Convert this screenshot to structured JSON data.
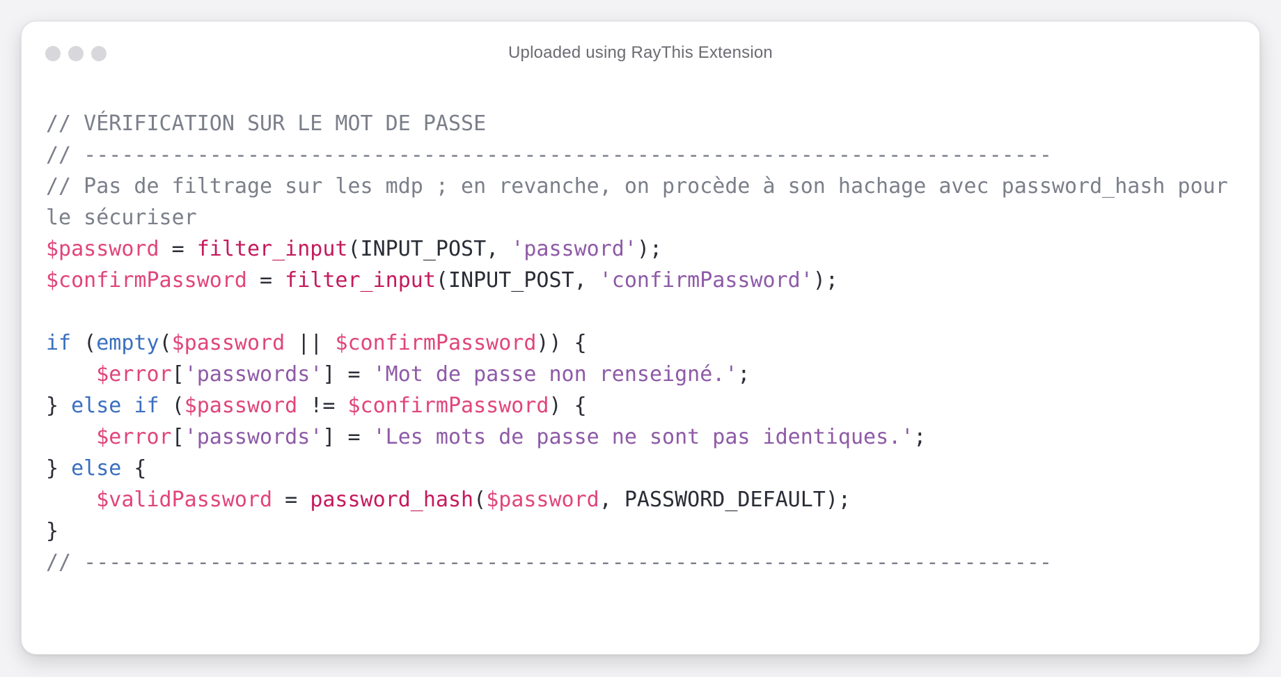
{
  "window": {
    "title": "Uploaded using RayThis Extension"
  },
  "colors": {
    "comment": "#7b7f8a",
    "variable": "#e0457b",
    "function": "#c41a5c",
    "string": "#8e5aa7",
    "keyword": "#3a6fbf",
    "plain": "#2a2c36"
  },
  "code": {
    "lines": [
      [
        {
          "t": "comment",
          "v": "// VÉRIFICATION SUR LE MOT DE PASSE"
        }
      ],
      [
        {
          "t": "comment",
          "v": "// -----------------------------------------------------------------------------"
        }
      ],
      [
        {
          "t": "comment",
          "v": "// Pas de filtrage sur les mdp ; en revanche, on procède à son hachage avec password_hash pour"
        }
      ],
      [
        {
          "t": "comment",
          "v": "le sécuriser"
        }
      ],
      [
        {
          "t": "var",
          "v": "$password"
        },
        {
          "t": "plain",
          "v": " = "
        },
        {
          "t": "func",
          "v": "filter_input"
        },
        {
          "t": "plain",
          "v": "(INPUT_POST, "
        },
        {
          "t": "str",
          "v": "'password'"
        },
        {
          "t": "plain",
          "v": ");"
        }
      ],
      [
        {
          "t": "var",
          "v": "$confirmPassword"
        },
        {
          "t": "plain",
          "v": " = "
        },
        {
          "t": "func",
          "v": "filter_input"
        },
        {
          "t": "plain",
          "v": "(INPUT_POST, "
        },
        {
          "t": "str",
          "v": "'confirmPassword'"
        },
        {
          "t": "plain",
          "v": ");"
        }
      ],
      [],
      [
        {
          "t": "kw",
          "v": "if"
        },
        {
          "t": "plain",
          "v": " ("
        },
        {
          "t": "kw",
          "v": "empty"
        },
        {
          "t": "plain",
          "v": "("
        },
        {
          "t": "var",
          "v": "$password"
        },
        {
          "t": "plain",
          "v": " || "
        },
        {
          "t": "var",
          "v": "$confirmPassword"
        },
        {
          "t": "plain",
          "v": ")) {"
        }
      ],
      [
        {
          "t": "plain",
          "v": "    "
        },
        {
          "t": "var",
          "v": "$error"
        },
        {
          "t": "plain",
          "v": "["
        },
        {
          "t": "str",
          "v": "'passwords'"
        },
        {
          "t": "plain",
          "v": "] = "
        },
        {
          "t": "str",
          "v": "'Mot de passe non renseigné.'"
        },
        {
          "t": "plain",
          "v": ";"
        }
      ],
      [
        {
          "t": "plain",
          "v": "} "
        },
        {
          "t": "kw",
          "v": "else"
        },
        {
          "t": "plain",
          "v": " "
        },
        {
          "t": "kw",
          "v": "if"
        },
        {
          "t": "plain",
          "v": " ("
        },
        {
          "t": "var",
          "v": "$password"
        },
        {
          "t": "plain",
          "v": " != "
        },
        {
          "t": "var",
          "v": "$confirmPassword"
        },
        {
          "t": "plain",
          "v": ") {"
        }
      ],
      [
        {
          "t": "plain",
          "v": "    "
        },
        {
          "t": "var",
          "v": "$error"
        },
        {
          "t": "plain",
          "v": "["
        },
        {
          "t": "str",
          "v": "'passwords'"
        },
        {
          "t": "plain",
          "v": "] = "
        },
        {
          "t": "str",
          "v": "'Les mots de passe ne sont pas identiques.'"
        },
        {
          "t": "plain",
          "v": ";"
        }
      ],
      [
        {
          "t": "plain",
          "v": "} "
        },
        {
          "t": "kw",
          "v": "else"
        },
        {
          "t": "plain",
          "v": " {"
        }
      ],
      [
        {
          "t": "plain",
          "v": "    "
        },
        {
          "t": "var",
          "v": "$validPassword"
        },
        {
          "t": "plain",
          "v": " = "
        },
        {
          "t": "func",
          "v": "password_hash"
        },
        {
          "t": "plain",
          "v": "("
        },
        {
          "t": "var",
          "v": "$password"
        },
        {
          "t": "plain",
          "v": ", PASSWORD_DEFAULT);"
        }
      ],
      [
        {
          "t": "plain",
          "v": "}"
        }
      ],
      [
        {
          "t": "comment",
          "v": "// -----------------------------------------------------------------------------"
        }
      ]
    ]
  }
}
